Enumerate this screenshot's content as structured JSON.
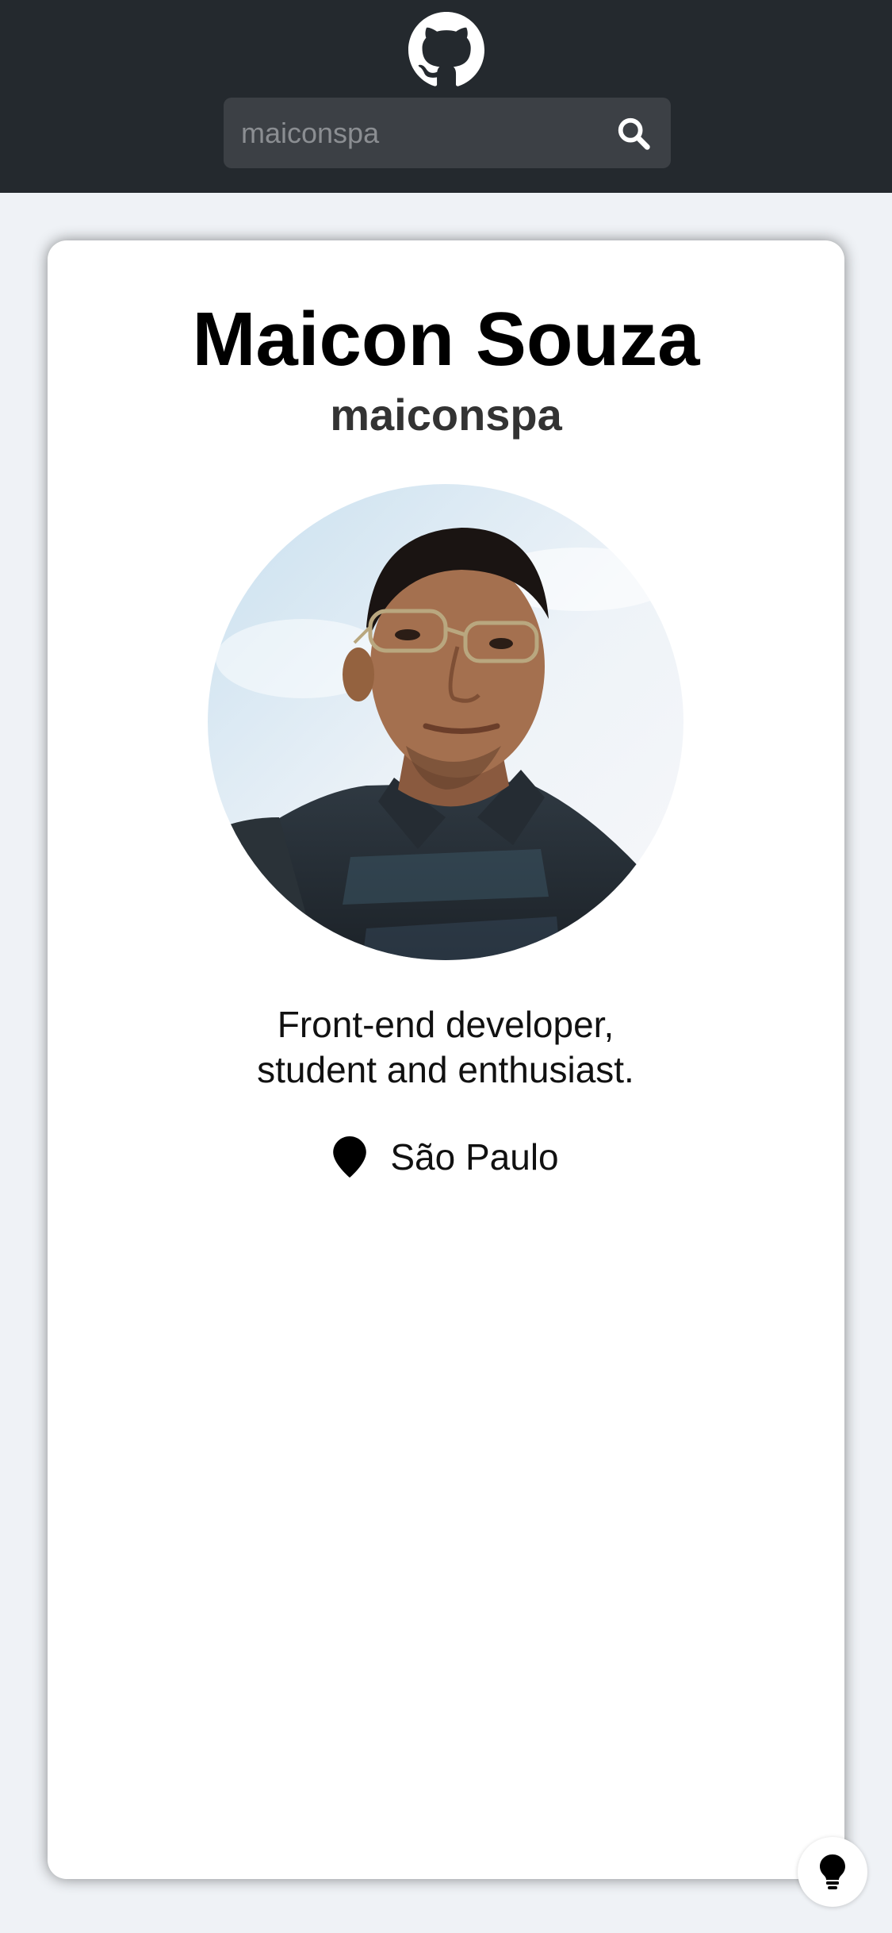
{
  "header": {
    "logo_icon": "github-icon",
    "search": {
      "value": "",
      "placeholder": "maiconspa",
      "icon": "search-icon"
    }
  },
  "profile": {
    "name": "Maicon Souza",
    "username": "maiconspa",
    "avatar_icon": "avatar",
    "bio_lines": [
      "Front-end developer,",
      "student and enthusiast."
    ],
    "location": {
      "icon": "map-pin-icon",
      "text": "São Paulo"
    }
  },
  "floating": {
    "theme_icon": "lightbulb-icon"
  },
  "colors": {
    "header_bg": "#24292e",
    "search_bg": "#3c4045",
    "page_bg": "#eff2f6",
    "card_bg": "#ffffff"
  }
}
